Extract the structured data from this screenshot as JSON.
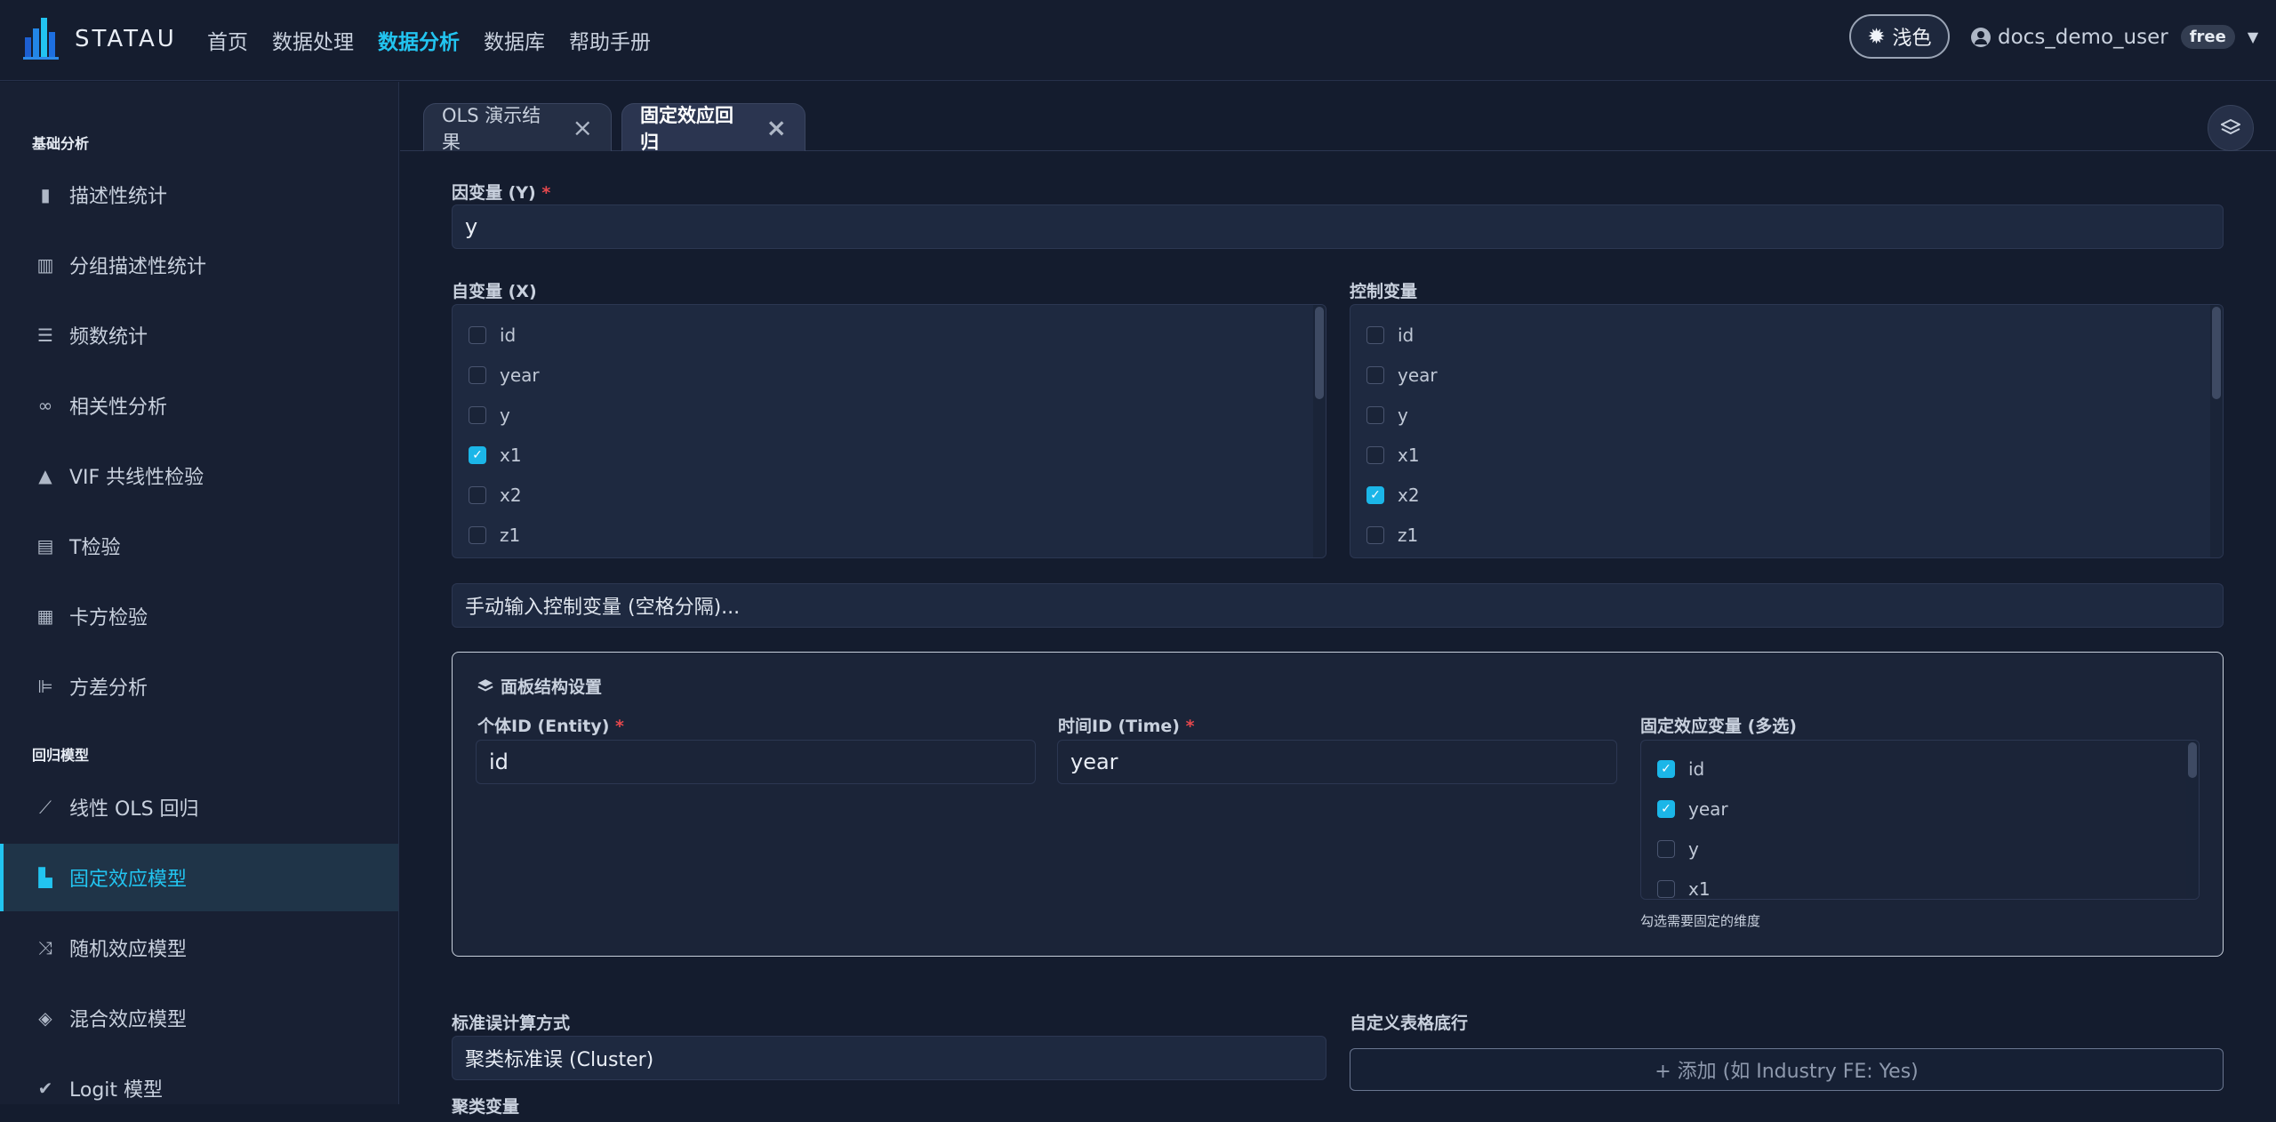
{
  "brand": {
    "name": "STATAU"
  },
  "nav": [
    "首页",
    "数据处理",
    "数据分析",
    "数据库",
    "帮助手册"
  ],
  "nav_active": "数据分析",
  "theme_toggle": {
    "label": "浅色"
  },
  "user": {
    "name": "docs_demo_user",
    "plan": "free"
  },
  "sidebar": {
    "sections": [
      {
        "title": "基础分析"
      },
      {
        "title": "回归模型"
      }
    ],
    "items": [
      {
        "label": "描述性统计",
        "icon": "bar-chart-icon"
      },
      {
        "label": "分组描述性统计",
        "icon": "grouped-chart-icon"
      },
      {
        "label": "频数统计",
        "icon": "table-list-icon"
      },
      {
        "label": "相关性分析",
        "icon": "link-icon"
      },
      {
        "label": "VIF 共线性检验",
        "icon": "warning-icon"
      },
      {
        "label": "T检验",
        "icon": "calculator-icon"
      },
      {
        "label": "卡方检验",
        "icon": "grid-icon"
      },
      {
        "label": "方差分析",
        "icon": "chart-lines-icon"
      },
      {
        "label": "线性 OLS 回归",
        "icon": "line-chart-icon"
      },
      {
        "label": "固定效应模型",
        "icon": "building-icon"
      },
      {
        "label": "随机效应模型",
        "icon": "shuffle-icon"
      },
      {
        "label": "混合效应模型",
        "icon": "layers-icon"
      },
      {
        "label": "Logit 模型",
        "icon": "check-circle-icon"
      }
    ],
    "active": "固定效应模型"
  },
  "tabs": [
    {
      "label": "OLS 演示结果"
    },
    {
      "label": "固定效应回归"
    }
  ],
  "form": {
    "dependent": {
      "label": "因变量 (Y)",
      "value": "y"
    },
    "independent": {
      "label": "自变量 (X)",
      "options": [
        {
          "name": "id",
          "checked": false
        },
        {
          "name": "year",
          "checked": false
        },
        {
          "name": "y",
          "checked": false
        },
        {
          "name": "x1",
          "checked": true
        },
        {
          "name": "x2",
          "checked": false
        },
        {
          "name": "z1",
          "checked": false
        }
      ]
    },
    "controls": {
      "label": "控制变量",
      "options": [
        {
          "name": "id",
          "checked": false
        },
        {
          "name": "year",
          "checked": false
        },
        {
          "name": "y",
          "checked": false
        },
        {
          "name": "x1",
          "checked": false
        },
        {
          "name": "x2",
          "checked": true
        },
        {
          "name": "z1",
          "checked": false
        }
      ]
    },
    "manual_controls_placeholder": "手动输入控制变量 (空格分隔)...",
    "panel": {
      "title": "面板结构设置",
      "entity": {
        "label": "个体ID (Entity)",
        "value": "id"
      },
      "time": {
        "label": "时间ID (Time)",
        "value": "year"
      },
      "fixed_effects": {
        "label": "固定效应变量 (多选)",
        "options": [
          {
            "name": "id",
            "checked": true
          },
          {
            "name": "year",
            "checked": true
          },
          {
            "name": "y",
            "checked": false
          },
          {
            "name": "x1",
            "checked": false
          }
        ],
        "hint": "勾选需要固定的维度"
      }
    },
    "se_method": {
      "label": "标准误计算方式",
      "value": "聚类标准误 (Cluster)"
    },
    "custom_footer": {
      "label": "自定义表格底行",
      "button": "+ 添加 (如 Industry FE: Yes)"
    },
    "cluster_var_label": "聚类变量"
  }
}
